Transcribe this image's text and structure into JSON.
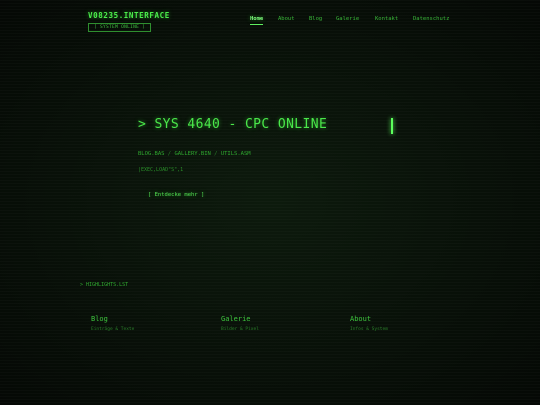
{
  "header": {
    "brand": "V08235.INTERFACE",
    "status_badge": "[ SYSTEM ONLINE ]"
  },
  "nav": {
    "items": [
      {
        "label": "Home",
        "active": true
      },
      {
        "label": "About",
        "active": false
      },
      {
        "label": "Blog",
        "active": false
      },
      {
        "label": "Galerie",
        "active": false
      },
      {
        "label": "Kontakt",
        "active": false
      },
      {
        "label": "Datenschutz",
        "active": false
      }
    ]
  },
  "hero": {
    "title": "> SYS 4640 - CPC ONLINE",
    "paths": [
      "BLOG.BAS",
      "GALLERY.BIN",
      "UTILS.ASM"
    ],
    "path_separator": " / ",
    "exec": "|EXEC,LOAD\"S\",1",
    "cta": "[ Entdecke mehr ]"
  },
  "highlights": {
    "label": "> HIGHLIGHTS.LST"
  },
  "cards": [
    {
      "title": "Blog",
      "subtitle": "Einträge & Texte"
    },
    {
      "title": "Galerie",
      "subtitle": "Bilder & Pixel"
    },
    {
      "title": "About",
      "subtitle": "Infos & System"
    }
  ],
  "colors": {
    "background": "#0a120a",
    "phosphor": "#3ddc3d",
    "accent": "#7dff7d"
  }
}
